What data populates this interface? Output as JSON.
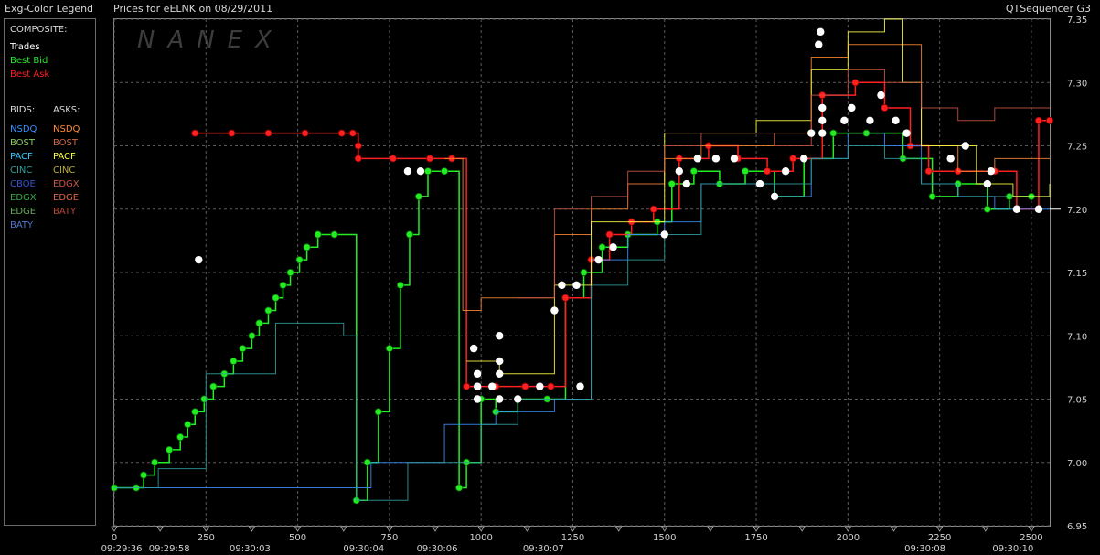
{
  "header": {
    "legend_title": "Exg-Color Legend",
    "chart_title": "Prices for  eELNK  on  08/29/2011",
    "source": "QTSequencer G3"
  },
  "legend": {
    "composite_label": "COMPOSITE:",
    "composite_items": [
      {
        "label": "Trades",
        "color": "#ffffff"
      },
      {
        "label": "Best Bid",
        "color": "#22ee22"
      },
      {
        "label": "Best Ask",
        "color": "#ff2020"
      }
    ],
    "bids_label": "BIDS:",
    "asks_label": "ASKS:",
    "bids": [
      {
        "label": "NSDQ",
        "color": "#3a8fff"
      },
      {
        "label": "BOST",
        "color": "#88cc66"
      },
      {
        "label": "PACF",
        "color": "#33ccff"
      },
      {
        "label": "CINC",
        "color": "#2f9f9f"
      },
      {
        "label": "CBOE",
        "color": "#3355cc"
      },
      {
        "label": "EDGX",
        "color": "#33aa44"
      },
      {
        "label": "EDGE",
        "color": "#66aa55"
      },
      {
        "label": "BATY",
        "color": "#5577cc"
      }
    ],
    "asks": [
      {
        "label": "NSDQ",
        "color": "#ff8833"
      },
      {
        "label": "BOST",
        "color": "#cc6644"
      },
      {
        "label": "PACF",
        "color": "#ffff44"
      },
      {
        "label": "CINC",
        "color": "#bbaa33"
      },
      {
        "label": "EDGX",
        "color": "#cc5544"
      },
      {
        "label": "EDGE",
        "color": "#dd6644"
      },
      {
        "label": "BATY",
        "color": "#bb4433"
      }
    ]
  },
  "watermark": "NANEX",
  "chart_data": {
    "type": "line",
    "ylim": [
      6.95,
      7.35
    ],
    "xlim": [
      0,
      2550
    ],
    "y_ticks": [
      6.95,
      7.0,
      7.05,
      7.1,
      7.15,
      7.2,
      7.25,
      7.3,
      7.35
    ],
    "y_tick_labels": [
      "6.95",
      "7.00",
      "7.05",
      "7.10",
      "7.15",
      "7.20",
      "7.25",
      "7.30",
      "7.35"
    ],
    "x_ticks": [
      0,
      250,
      500,
      750,
      1000,
      1250,
      1500,
      1750,
      2000,
      2250,
      2500
    ],
    "x_tick_labels": [
      "0",
      "250",
      "500",
      "750",
      "1000",
      "1250",
      "1500",
      "1750",
      "2000",
      "2250",
      "2500"
    ],
    "time_labels": [
      {
        "x": 20,
        "label": "09:29:36"
      },
      {
        "x": 150,
        "label": "09:29:58"
      },
      {
        "x": 370,
        "label": "09:30:03"
      },
      {
        "x": 680,
        "label": "09:30:04"
      },
      {
        "x": 880,
        "label": "09:30:06"
      },
      {
        "x": 1170,
        "label": "09:30:07"
      },
      {
        "x": 2210,
        "label": "09:30:08"
      },
      {
        "x": 2450,
        "label": "09:30:10"
      }
    ],
    "last_price": 7.2,
    "series": [
      {
        "name": "Best Bid",
        "color": "#22ee22",
        "points": [
          [
            0,
            6.98
          ],
          [
            60,
            6.98
          ],
          [
            80,
            6.99
          ],
          [
            110,
            7.0
          ],
          [
            150,
            7.01
          ],
          [
            180,
            7.02
          ],
          [
            200,
            7.03
          ],
          [
            220,
            7.04
          ],
          [
            245,
            7.05
          ],
          [
            270,
            7.06
          ],
          [
            300,
            7.07
          ],
          [
            325,
            7.08
          ],
          [
            350,
            7.09
          ],
          [
            375,
            7.1
          ],
          [
            395,
            7.11
          ],
          [
            420,
            7.12
          ],
          [
            440,
            7.13
          ],
          [
            460,
            7.14
          ],
          [
            480,
            7.15
          ],
          [
            505,
            7.16
          ],
          [
            525,
            7.17
          ],
          [
            555,
            7.18
          ],
          [
            600,
            7.18
          ],
          [
            660,
            6.97
          ],
          [
            690,
            7.0
          ],
          [
            720,
            7.04
          ],
          [
            750,
            7.09
          ],
          [
            780,
            7.14
          ],
          [
            805,
            7.18
          ],
          [
            830,
            7.21
          ],
          [
            855,
            7.23
          ],
          [
            900,
            7.23
          ],
          [
            940,
            6.98
          ],
          [
            960,
            7.0
          ],
          [
            1000,
            7.05
          ],
          [
            1040,
            7.04
          ],
          [
            1100,
            7.05
          ],
          [
            1180,
            7.05
          ],
          [
            1230,
            7.13
          ],
          [
            1280,
            7.15
          ],
          [
            1330,
            7.17
          ],
          [
            1400,
            7.18
          ],
          [
            1480,
            7.19
          ],
          [
            1520,
            7.22
          ],
          [
            1580,
            7.23
          ],
          [
            1650,
            7.22
          ],
          [
            1720,
            7.23
          ],
          [
            1800,
            7.21
          ],
          [
            1880,
            7.24
          ],
          [
            1960,
            7.26
          ],
          [
            2050,
            7.26
          ],
          [
            2150,
            7.24
          ],
          [
            2230,
            7.21
          ],
          [
            2300,
            7.22
          ],
          [
            2380,
            7.2
          ],
          [
            2440,
            7.21
          ],
          [
            2500,
            7.21
          ]
        ]
      },
      {
        "name": "Best Ask",
        "color": "#ff2020",
        "points": [
          [
            220,
            7.26
          ],
          [
            320,
            7.26
          ],
          [
            420,
            7.26
          ],
          [
            520,
            7.26
          ],
          [
            620,
            7.26
          ],
          [
            650,
            7.26
          ],
          [
            665,
            7.25
          ],
          [
            665,
            7.24
          ],
          [
            760,
            7.24
          ],
          [
            860,
            7.24
          ],
          [
            920,
            7.24
          ],
          [
            960,
            7.06
          ],
          [
            1040,
            7.06
          ],
          [
            1120,
            7.06
          ],
          [
            1190,
            7.06
          ],
          [
            1230,
            7.13
          ],
          [
            1300,
            7.16
          ],
          [
            1350,
            7.18
          ],
          [
            1410,
            7.19
          ],
          [
            1470,
            7.2
          ],
          [
            1540,
            7.24
          ],
          [
            1620,
            7.25
          ],
          [
            1700,
            7.24
          ],
          [
            1780,
            7.23
          ],
          [
            1850,
            7.24
          ],
          [
            1930,
            7.29
          ],
          [
            2020,
            7.3
          ],
          [
            2100,
            7.28
          ],
          [
            2170,
            7.25
          ],
          [
            2220,
            7.23
          ],
          [
            2300,
            7.23
          ],
          [
            2400,
            7.23
          ],
          [
            2460,
            7.2
          ],
          [
            2520,
            7.27
          ],
          [
            2550,
            7.27
          ]
        ]
      },
      {
        "name": "Trades",
        "color": "#ffffff",
        "points": [
          [
            230,
            7.16
          ],
          [
            800,
            7.23
          ],
          [
            835,
            7.23
          ],
          [
            980,
            7.09
          ],
          [
            990,
            7.07
          ],
          [
            990,
            7.06
          ],
          [
            990,
            7.05
          ],
          [
            1030,
            7.06
          ],
          [
            1050,
            7.1
          ],
          [
            1050,
            7.08
          ],
          [
            1050,
            7.07
          ],
          [
            1050,
            7.05
          ],
          [
            1100,
            7.05
          ],
          [
            1160,
            7.06
          ],
          [
            1200,
            7.12
          ],
          [
            1220,
            7.14
          ],
          [
            1260,
            7.14
          ],
          [
            1270,
            7.06
          ],
          [
            1320,
            7.16
          ],
          [
            1360,
            7.17
          ],
          [
            1500,
            7.18
          ],
          [
            1540,
            7.23
          ],
          [
            1560,
            7.22
          ],
          [
            1590,
            7.24
          ],
          [
            1640,
            7.24
          ],
          [
            1690,
            7.24
          ],
          [
            1760,
            7.22
          ],
          [
            1800,
            7.21
          ],
          [
            1830,
            7.23
          ],
          [
            1880,
            7.24
          ],
          [
            1900,
            7.26
          ],
          [
            1920,
            7.33
          ],
          [
            1925,
            7.34
          ],
          [
            1930,
            7.27
          ],
          [
            1930,
            7.28
          ],
          [
            1930,
            7.26
          ],
          [
            1990,
            7.27
          ],
          [
            2010,
            7.28
          ],
          [
            2060,
            7.27
          ],
          [
            2090,
            7.29
          ],
          [
            2130,
            7.27
          ],
          [
            2160,
            7.26
          ],
          [
            2280,
            7.24
          ],
          [
            2320,
            7.25
          ],
          [
            2380,
            7.22
          ],
          [
            2390,
            7.23
          ],
          [
            2460,
            7.2
          ],
          [
            2520,
            7.2
          ]
        ]
      },
      {
        "name": "NSDQ",
        "color": "#3a8fff",
        "points": [
          [
            0,
            6.98
          ],
          [
            700,
            6.98
          ],
          [
            700,
            7.0
          ],
          [
            900,
            7.0
          ],
          [
            900,
            7.03
          ],
          [
            1000,
            7.03
          ],
          [
            1040,
            7.04
          ],
          [
            1200,
            7.05
          ],
          [
            1300,
            7.16
          ],
          [
            1400,
            7.18
          ],
          [
            1500,
            7.19
          ],
          [
            1600,
            7.22
          ],
          [
            1700,
            7.22
          ],
          [
            1800,
            7.21
          ],
          [
            1900,
            7.24
          ],
          [
            2000,
            7.26
          ],
          [
            2100,
            7.25
          ],
          [
            2200,
            7.22
          ],
          [
            2300,
            7.21
          ],
          [
            2400,
            7.2
          ],
          [
            2500,
            7.2
          ],
          [
            2550,
            7.2
          ]
        ]
      },
      {
        "name": "CINC",
        "color": "#2f9f9f",
        "points": [
          [
            0,
            6.98
          ],
          [
            80,
            6.98
          ],
          [
            120,
            6.995
          ],
          [
            250,
            6.995
          ],
          [
            250,
            7.07
          ],
          [
            440,
            7.07
          ],
          [
            440,
            7.11
          ],
          [
            625,
            7.11
          ],
          [
            625,
            7.1
          ],
          [
            660,
            7.1
          ],
          [
            660,
            6.97
          ],
          [
            700,
            6.97
          ],
          [
            800,
            7.0
          ],
          [
            900,
            7.0
          ],
          [
            1000,
            7.03
          ],
          [
            1100,
            7.05
          ],
          [
            1200,
            7.05
          ],
          [
            1300,
            7.14
          ],
          [
            1400,
            7.16
          ],
          [
            1500,
            7.18
          ],
          [
            1600,
            7.22
          ],
          [
            1700,
            7.22
          ],
          [
            1800,
            7.22
          ],
          [
            1900,
            7.24
          ],
          [
            2000,
            7.25
          ],
          [
            2100,
            7.24
          ],
          [
            2200,
            7.22
          ],
          [
            2300,
            7.21
          ],
          [
            2400,
            7.21
          ],
          [
            2550,
            7.21
          ]
        ]
      },
      {
        "name": "NSDQ ask",
        "color": "#ff8833",
        "points": [
          [
            900,
            7.24
          ],
          [
            950,
            7.12
          ],
          [
            1000,
            7.13
          ],
          [
            1100,
            7.13
          ],
          [
            1200,
            7.18
          ],
          [
            1300,
            7.2
          ],
          [
            1400,
            7.22
          ],
          [
            1500,
            7.24
          ],
          [
            1600,
            7.25
          ],
          [
            1700,
            7.25
          ],
          [
            1800,
            7.26
          ],
          [
            1900,
            7.32
          ],
          [
            2000,
            7.33
          ],
          [
            2100,
            7.33
          ],
          [
            2200,
            7.25
          ],
          [
            2300,
            7.23
          ],
          [
            2400,
            7.24
          ],
          [
            2500,
            7.24
          ],
          [
            2550,
            7.24
          ]
        ]
      },
      {
        "name": "PACF ask",
        "color": "#ffff44",
        "points": [
          [
            960,
            7.08
          ],
          [
            1050,
            7.07
          ],
          [
            1200,
            7.14
          ],
          [
            1300,
            7.19
          ],
          [
            1500,
            7.26
          ],
          [
            1600,
            7.26
          ],
          [
            1750,
            7.27
          ],
          [
            1900,
            7.31
          ],
          [
            2000,
            7.34
          ],
          [
            2100,
            7.35
          ],
          [
            2150,
            7.3
          ],
          [
            2200,
            7.25
          ],
          [
            2350,
            7.22
          ],
          [
            2450,
            7.21
          ],
          [
            2550,
            7.22
          ]
        ]
      },
      {
        "name": "EDGX ask",
        "color": "#cc5544",
        "points": [
          [
            1100,
            7.13
          ],
          [
            1200,
            7.2
          ],
          [
            1300,
            7.21
          ],
          [
            1400,
            7.23
          ],
          [
            1500,
            7.25
          ],
          [
            1600,
            7.26
          ],
          [
            1700,
            7.26
          ],
          [
            1800,
            7.25
          ],
          [
            1900,
            7.29
          ],
          [
            2000,
            7.31
          ],
          [
            2100,
            7.3
          ],
          [
            2200,
            7.28
          ],
          [
            2300,
            7.27
          ],
          [
            2400,
            7.28
          ],
          [
            2550,
            7.28
          ]
        ]
      }
    ]
  }
}
